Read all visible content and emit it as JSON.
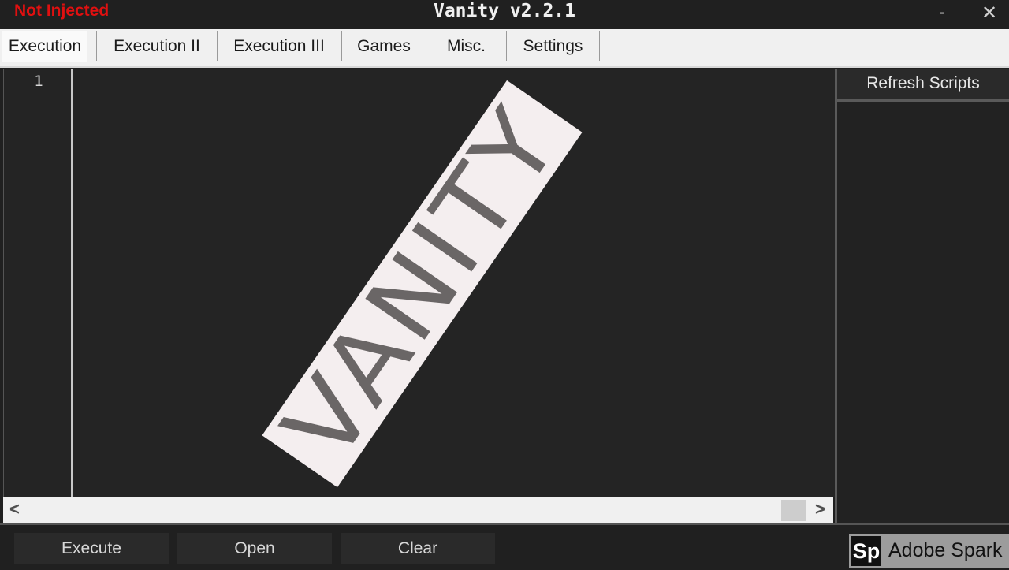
{
  "titlebar": {
    "status": "Not Injected",
    "status_color": "#e01010",
    "title": "Vanity v2.2.1",
    "minimize_icon": "minimize-icon",
    "close_icon": "close-icon",
    "minimize_glyph": "-",
    "close_glyph": "✕"
  },
  "tabs": [
    {
      "label": "Execution",
      "active": true
    },
    {
      "label": "Execution II"
    },
    {
      "label": "Execution III"
    },
    {
      "label": "Games"
    },
    {
      "label": "Misc."
    },
    {
      "label": "Settings"
    }
  ],
  "editor": {
    "line_numbers": [
      "1"
    ],
    "content": "",
    "watermark": "VANITY"
  },
  "scrollbar": {
    "left_arrow": "<",
    "right_arrow": ">"
  },
  "side_panel": {
    "refresh_label": "Refresh Scripts",
    "scripts": []
  },
  "buttons": {
    "execute": "Execute",
    "open": "Open",
    "clear": "Clear"
  },
  "overlay": {
    "logo": "Sp",
    "text": "Adobe Spark"
  }
}
